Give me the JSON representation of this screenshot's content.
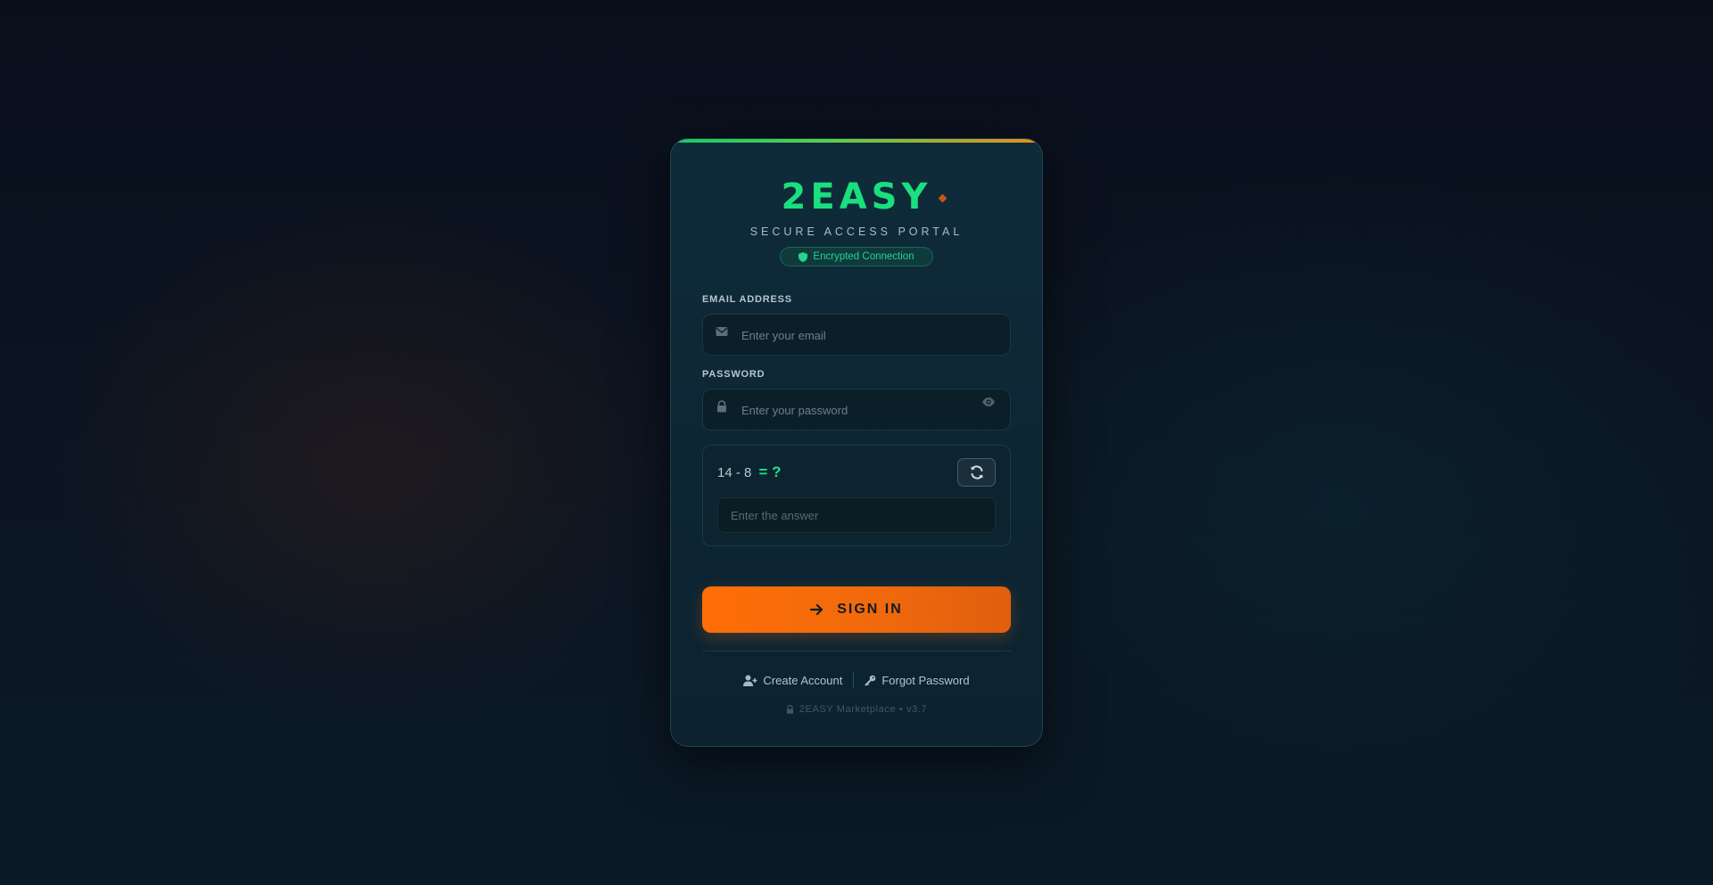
{
  "brand": {
    "name": "2EASY",
    "subtitle": "SECURE ACCESS PORTAL",
    "badge": "Encrypted Connection"
  },
  "form": {
    "email": {
      "label": "EMAIL ADDRESS",
      "placeholder": "Enter your email",
      "icon": "envelope-icon"
    },
    "password": {
      "label": "PASSWORD",
      "placeholder": "Enter your password",
      "icon": "lock-icon",
      "toggle_icon": "eye-icon"
    },
    "captcha": {
      "question": "14 - 8",
      "equals": "= ?",
      "answer_placeholder": "Enter the answer",
      "refresh_icon": "refresh-icon"
    },
    "submit_label": "SIGN IN"
  },
  "links": {
    "create_account": "Create Account",
    "forgot_password": "Forgot Password"
  },
  "footer": "2EASY Marketplace • v3.7",
  "colors": {
    "accent_green": "#19e07e",
    "accent_orange": "#ff6e07",
    "card_bg": "#0f2b3a",
    "page_bg": "#0a0f1c"
  }
}
